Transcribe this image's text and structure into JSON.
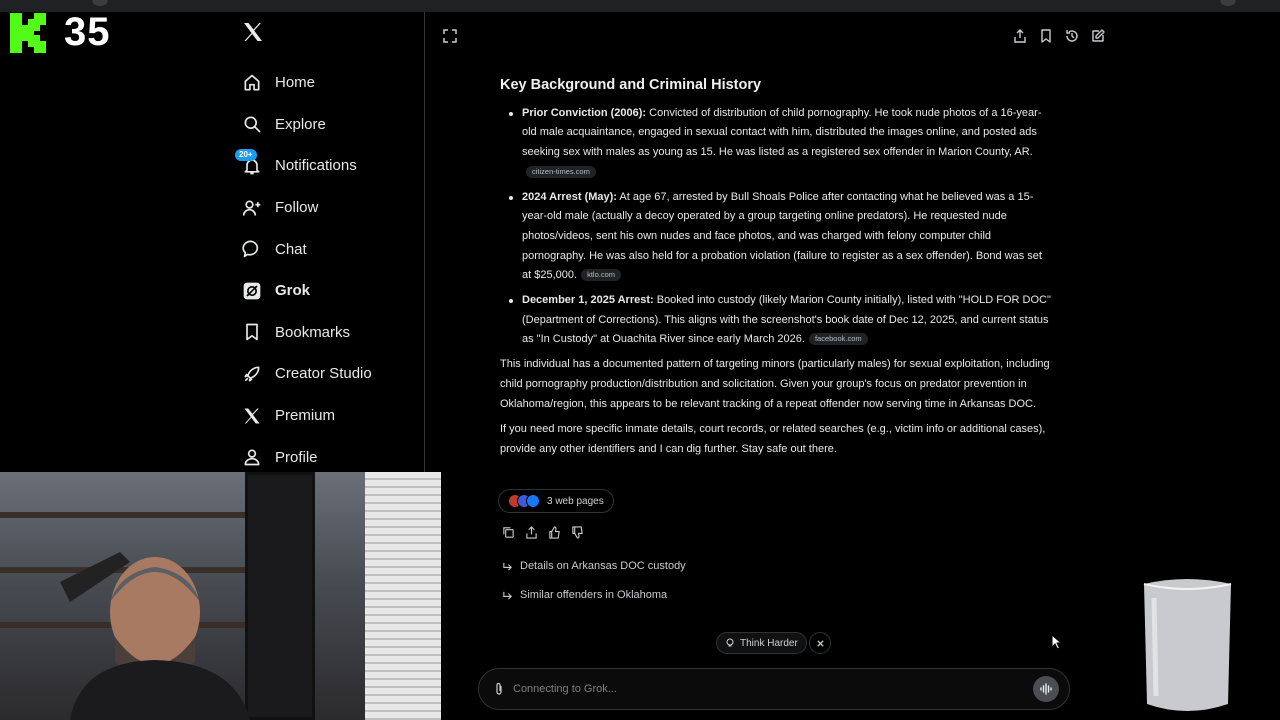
{
  "overlay": {
    "counter": "35"
  },
  "nav": {
    "items": [
      {
        "label": "Home",
        "icon": "home-icon"
      },
      {
        "label": "Explore",
        "icon": "search-icon"
      },
      {
        "label": "Notifications",
        "icon": "bell-icon",
        "badge": "20+"
      },
      {
        "label": "Follow",
        "icon": "person-plus-icon"
      },
      {
        "label": "Chat",
        "icon": "chat-icon"
      },
      {
        "label": "Grok",
        "icon": "grok-icon",
        "active": true
      },
      {
        "label": "Bookmarks",
        "icon": "bookmark-icon"
      },
      {
        "label": "Creator Studio",
        "icon": "rocket-icon"
      },
      {
        "label": "Premium",
        "icon": "x-icon"
      },
      {
        "label": "Profile",
        "icon": "profile-icon"
      }
    ]
  },
  "response": {
    "heading": "Key Background and Criminal History",
    "bullets": [
      {
        "title": "Prior Conviction (2006):",
        "text": " Convicted of distribution of child pornography. He took nude photos of a 16-year-old male acquaintance, engaged in sexual contact with him, distributed the images online, and posted ads seeking sex with males as young as 15. He was listed as a registered sex offender in Marion County, AR.",
        "source": "citizen-times.com"
      },
      {
        "title": "2024 Arrest (May):",
        "text": " At age 67, arrested by Bull Shoals Police after contacting what he believed was a 15-year-old male (actually a decoy operated by a group targeting online predators). He requested nude photos/videos, sent his own nudes and face photos, and was charged with felony computer child pornography. He was also held for a probation violation (failure to register as a sex offender). Bond was set at $25,000.",
        "source": "ktlo.com"
      },
      {
        "title": "December 1, 2025 Arrest:",
        "text": " Booked into custody (likely Marion County initially), listed with \"HOLD FOR DOC\" (Department of Corrections). This aligns with the screenshot's book date of Dec 12, 2025, and current status as \"In Custody\" at Ouachita River since early March 2026.",
        "source": "facebook.com"
      }
    ],
    "paragraph1": "This individual has a documented pattern of targeting minors (particularly males) for sexual exploitation, including child pornography production/distribution and solicitation. Given your group's focus on predator prevention in Oklahoma/region, this appears to be relevant tracking of a repeat offender now serving time in Arkansas DOC.",
    "paragraph2": "If you need more specific inmate details, court records, or related searches (e.g., victim info or additional cases), provide any other identifiers and I can dig further. Stay safe out there.",
    "web_pages_label": "3 web pages"
  },
  "followups": [
    "Details on Arkansas DOC custody",
    "Similar offenders in Oklahoma"
  ],
  "think_harder": {
    "label": "Think Harder"
  },
  "composer": {
    "placeholder": "Connecting to Grok..."
  },
  "colors": {
    "accent": "#1d9bf0",
    "background": "#000000",
    "border": "#2f3336",
    "logo_green": "#53fc18"
  }
}
